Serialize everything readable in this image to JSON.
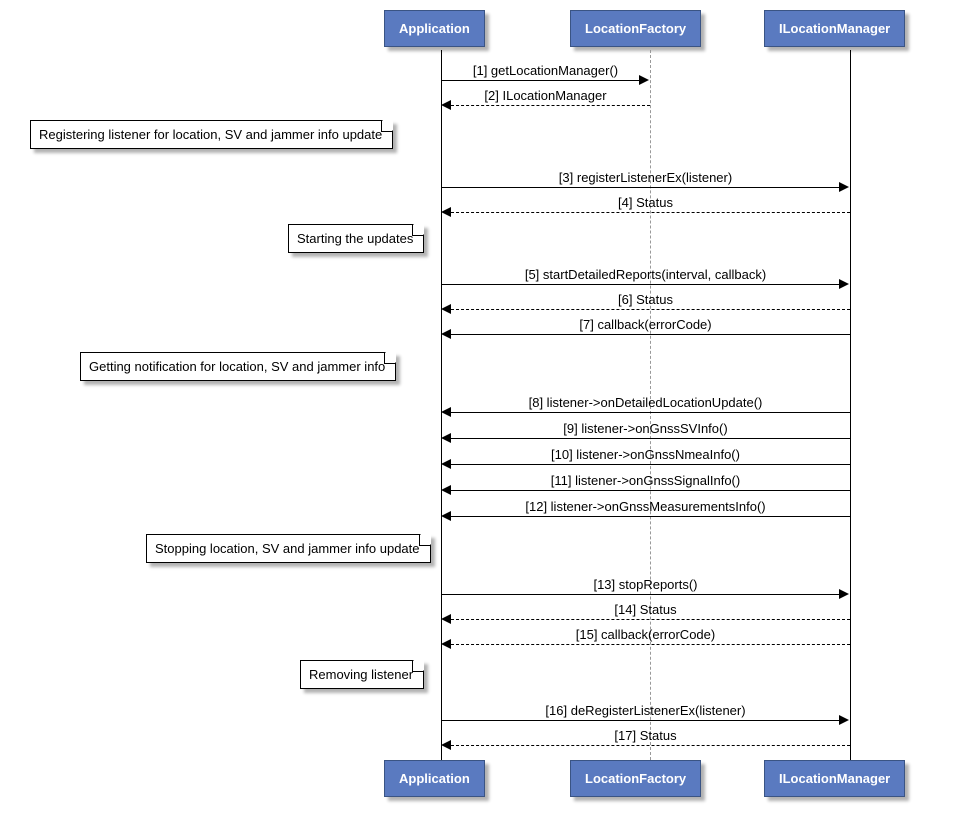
{
  "participants": {
    "app": "Application",
    "factory": "LocationFactory",
    "manager": "ILocationManager"
  },
  "notes": {
    "n1": "Registering listener for location, SV and jammer info update",
    "n2": "Starting the updates",
    "n3": "Getting notification for location, SV and jammer info",
    "n4": "Stopping location, SV and jammer info update",
    "n5": "Removing listener"
  },
  "messages": {
    "m1": "[1] getLocationManager()",
    "m2": "[2] ILocationManager",
    "m3": "[3] registerListenerEx(listener)",
    "m4": "[4] Status",
    "m5": "[5] startDetailedReports(interval, callback)",
    "m6": "[6] Status",
    "m7": "[7] callback(errorCode)",
    "m8": "[8] listener->onDetailedLocationUpdate()",
    "m9": "[9] listener->onGnssSVInfo()",
    "m10": "[10] listener->onGnssNmeaInfo()",
    "m11": "[11] listener->onGnssSignalInfo()",
    "m12": "[12] listener->onGnssMeasurementsInfo()",
    "m13": "[13] stopReports()",
    "m14": "[14] Status",
    "m15": "[15] callback(errorCode)",
    "m16": "[16] deRegisterListenerEx(listener)",
    "m17": "[17] Status"
  }
}
